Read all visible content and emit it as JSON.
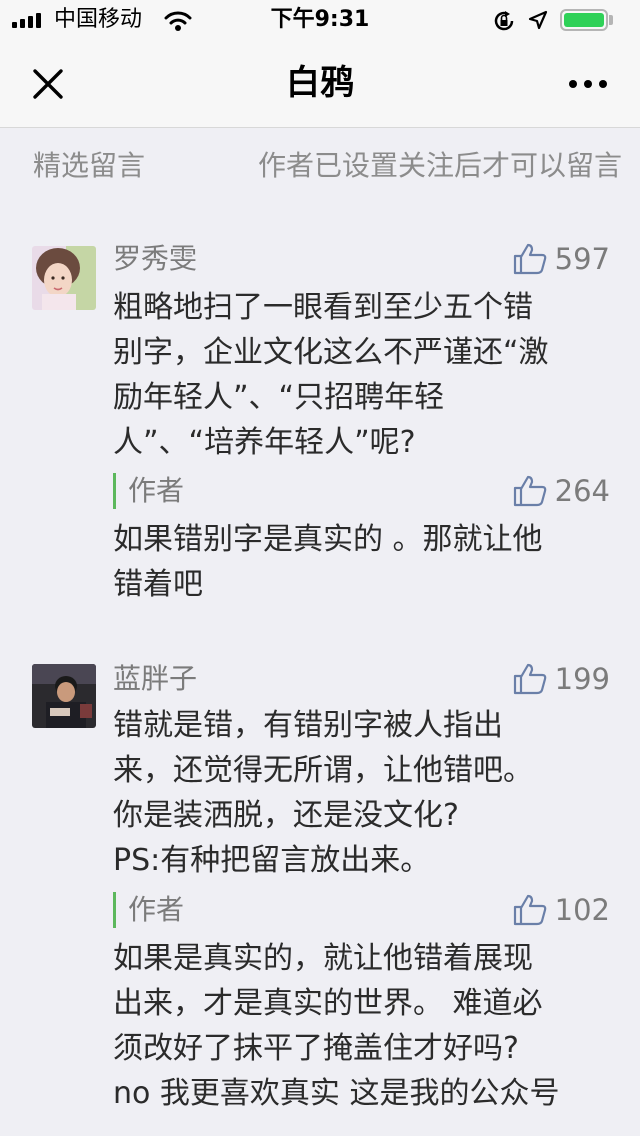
{
  "status_bar": {
    "carrier": "中国移动",
    "time": "下午9:31",
    "battery_level": 1.0
  },
  "nav": {
    "title": "白鸦"
  },
  "section": {
    "featured_label": "精选留言",
    "notice": "作者已设置关注后才可以留言"
  },
  "comments": [
    {
      "author": "罗秀雯",
      "likes": "597",
      "text_lines": [
        "粗略地扫了一眼看到至少五个错",
        "别字，企业文化这么不严谨还“激",
        "励年轻人”、“只招聘年轻",
        "人”、“培养年轻人”呢?"
      ],
      "reply": {
        "label": "作者",
        "likes": "264",
        "text_lines": [
          "如果错别字是真实的 。那就让他",
          "错着吧"
        ]
      }
    },
    {
      "author": "蓝胖子",
      "likes": "199",
      "text_lines": [
        "错就是错，有错别字被人指出",
        "来，还觉得无所谓，让他错吧。",
        "你是装洒脱，还是没文化?",
        "PS:有种把留言放出来。"
      ],
      "reply": {
        "label": "作者",
        "likes": "102",
        "text_lines": [
          "如果是真实的，就让他错着展现",
          "出来，才是真实的世界。 难道必",
          "须改好了抹平了掩盖住才好吗?",
          "no 我更喜欢真实 这是我的公众号"
        ]
      }
    }
  ],
  "colors": {
    "background": "#efeff4",
    "reply_accent": "#5cb85c",
    "secondary_text": "#7b7b7b",
    "battery": "#2fd158"
  }
}
